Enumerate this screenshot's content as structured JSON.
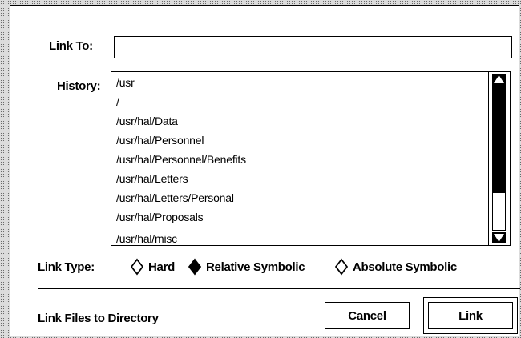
{
  "dialog": {
    "link_to_label": "Link To:",
    "link_to_value": "",
    "history_label": "History:",
    "history": [
      "/usr",
      "/",
      "/usr/hal/Data",
      "/usr/hal/Personnel",
      "/usr/hal/Personnel/Benefits",
      "/usr/hal/Letters",
      "/usr/hal/Letters/Personal",
      "/usr/hal/Proposals",
      "/usr/hal/misc"
    ],
    "link_type_label": "Link Type:",
    "link_types": [
      {
        "label": "Hard",
        "selected": false
      },
      {
        "label": "Relative Symbolic",
        "selected": true
      },
      {
        "label": "Absolute Symbolic",
        "selected": false
      }
    ],
    "status_text": "Link Files to Directory",
    "cancel_label": "Cancel",
    "link_label": "Link"
  },
  "icons": {
    "scroll_up": "scroll-up-arrow",
    "scroll_down": "scroll-down-arrow",
    "radio_unselected": "hollow-diamond",
    "radio_selected": "filled-diamond"
  }
}
